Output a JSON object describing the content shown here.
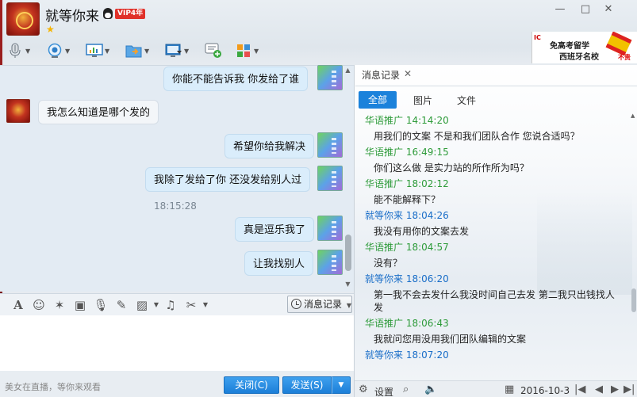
{
  "header": {
    "avatar_alt": "",
    "contact_name": "就等你来",
    "vip_badge": "VIP4年",
    "window_controls": [
      "—",
      "□",
      "✕"
    ]
  },
  "ad": {
    "line1": "免高考留学",
    "line2": "西班牙名校",
    "tag": "不贵",
    "logo": "IC"
  },
  "chat": {
    "messages": [
      {
        "side": "me",
        "text": "你能不能告诉我   你发给了谁"
      },
      {
        "side": "them",
        "text": "我怎么知道是哪个发的"
      },
      {
        "side": "me",
        "text": "希望你给我解决"
      },
      {
        "side": "me",
        "text": "我除了发给了你  还没发给别人过"
      },
      {
        "side": "time",
        "text": "18:15:28"
      },
      {
        "side": "me",
        "text": "真是逗乐我了"
      },
      {
        "side": "me",
        "text": "让我找别人"
      }
    ]
  },
  "input_toolbar": {
    "history_button": "消息记录"
  },
  "bottom": {
    "promo_text": "美女在直播，等你来观看",
    "close_button": "关闭(C)",
    "send_button": "发送(S)"
  },
  "history_panel": {
    "tab_title": "消息记录",
    "filters": [
      "全部",
      "图片",
      "文件"
    ],
    "active_filter": "全部",
    "entries": [
      {
        "who": "them",
        "sender": "华语推广",
        "time": "14:14:20",
        "text": "用我们的文案  不是和我们团队合作   您说合适吗？"
      },
      {
        "who": "them",
        "sender": "华语推广",
        "time": "16:49:15",
        "text": "你们这么做    是实力站的所作所为吗？"
      },
      {
        "who": "them",
        "sender": "华语推广",
        "time": "18:02:12",
        "text": "能不能解释下？"
      },
      {
        "who": "me",
        "sender": "就等你来",
        "time": "18:04:26",
        "text": "我没有用你的文案去发"
      },
      {
        "who": "them",
        "sender": "华语推广",
        "time": "18:04:57",
        "text": "没有？"
      },
      {
        "who": "me",
        "sender": "就等你来",
        "time": "18:06:20",
        "text": "第一我不会去发什么我没时间自己去发 第二我只出钱找人发"
      },
      {
        "who": "them",
        "sender": "华语推广",
        "time": "18:06:43",
        "text": "我就问您用没用我们团队编辑的文案"
      },
      {
        "who": "me",
        "sender": "就等你来",
        "time": "18:07:20",
        "text": ""
      }
    ],
    "footer": {
      "settings_label": "设置",
      "date": "2016-10-3"
    }
  },
  "colors": {
    "accent": "#1b82db",
    "them_name": "#2e9b3a",
    "me_name": "#1a6ec8"
  }
}
